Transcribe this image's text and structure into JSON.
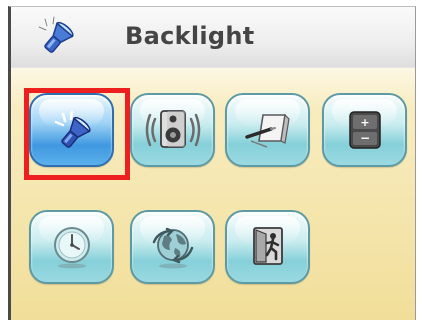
{
  "header": {
    "title": "Backlight",
    "icon": "flashlight-icon"
  },
  "grid": {
    "selected_index": 0,
    "items": [
      {
        "icon": "flashlight-icon",
        "active": true
      },
      {
        "icon": "speaker-icon",
        "active": false
      },
      {
        "icon": "pen-icon",
        "active": false
      },
      {
        "icon": "calculator-icon",
        "active": false
      },
      {
        "icon": "clock-icon",
        "active": false
      },
      {
        "icon": "globe-icon",
        "active": false
      },
      {
        "icon": "exit-door-icon",
        "active": false
      }
    ]
  },
  "colors": {
    "selection_border": "#ee1f1f",
    "tile_accent": "#86d0d9",
    "active_tile_accent": "#3f98e0",
    "background": "#f7eab9"
  }
}
